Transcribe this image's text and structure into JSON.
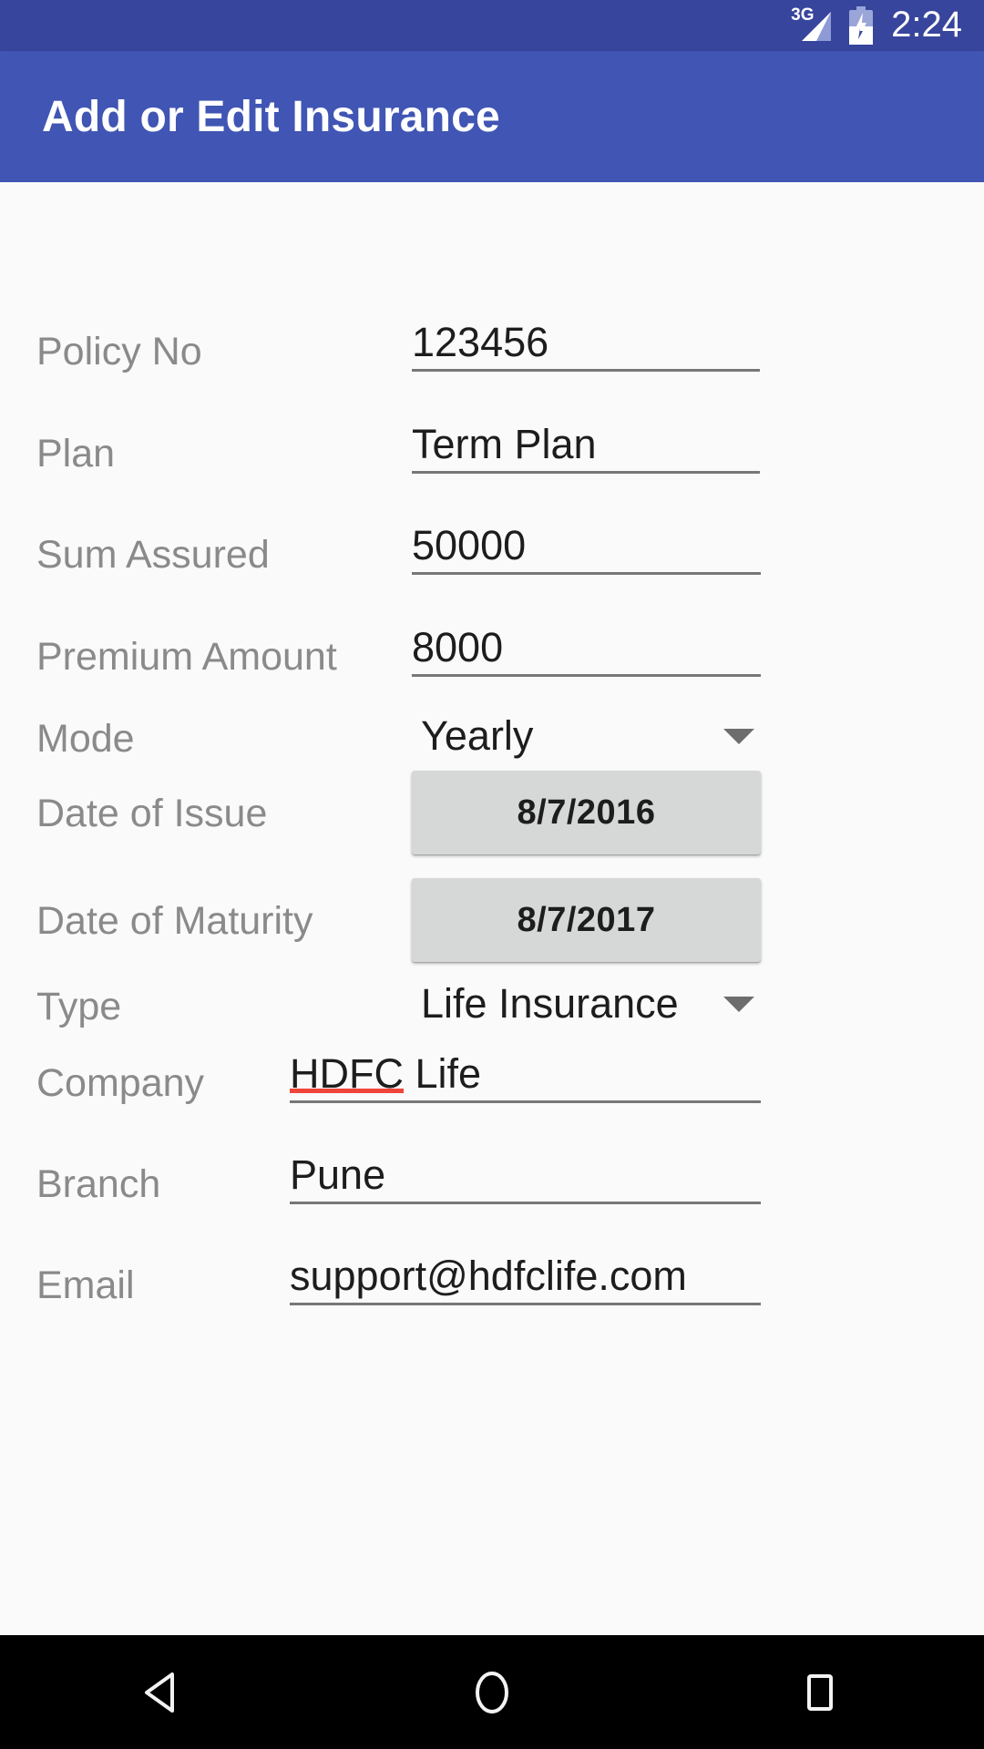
{
  "statusbar": {
    "network_label": "3G",
    "time": "2:24",
    "signal_icon": "signal-3g-icon",
    "battery_icon": "battery-charging-icon"
  },
  "appbar": {
    "title": "Add or Edit Insurance",
    "background_color": "#4055b4"
  },
  "form": {
    "fields": [
      {
        "label": "Policy No",
        "value": "123456",
        "type": "text"
      },
      {
        "label": "Plan",
        "value": "Term Plan",
        "type": "text"
      },
      {
        "label": "Sum Assured",
        "value": "50000",
        "type": "text"
      },
      {
        "label": "Premium Amount",
        "value": "8000",
        "type": "text"
      },
      {
        "label": "Mode",
        "value": "Yearly",
        "type": "spinner"
      },
      {
        "label": "Date of Issue",
        "value": "8/7/2016",
        "type": "date-button"
      },
      {
        "label": "Date of Maturity",
        "value": "8/7/2017",
        "type": "date-button"
      },
      {
        "label": "Type",
        "value": "Life Insurance",
        "type": "spinner"
      },
      {
        "label": "Company",
        "value": "HDFC Life",
        "type": "text",
        "misspelled_part": "HDFC",
        "rest_part": " Life"
      },
      {
        "label": "Branch",
        "value": "Pune",
        "type": "text"
      },
      {
        "label": "Email",
        "value": "support@hdfclife.com",
        "type": "text"
      }
    ]
  },
  "navbar": {
    "back_icon": "back-triangle-icon",
    "home_icon": "home-circle-icon",
    "recents_icon": "recents-square-icon"
  },
  "colors": {
    "status_bar": "#37459c",
    "app_bar": "#4055b4",
    "page_background": "#fafafa",
    "label_text": "#8a8a8a",
    "value_text": "#1d1d1d",
    "underline": "#777777",
    "date_button": "#d6d7d7",
    "spellcheck": "#f0453a",
    "nav_bar": "#000000"
  }
}
